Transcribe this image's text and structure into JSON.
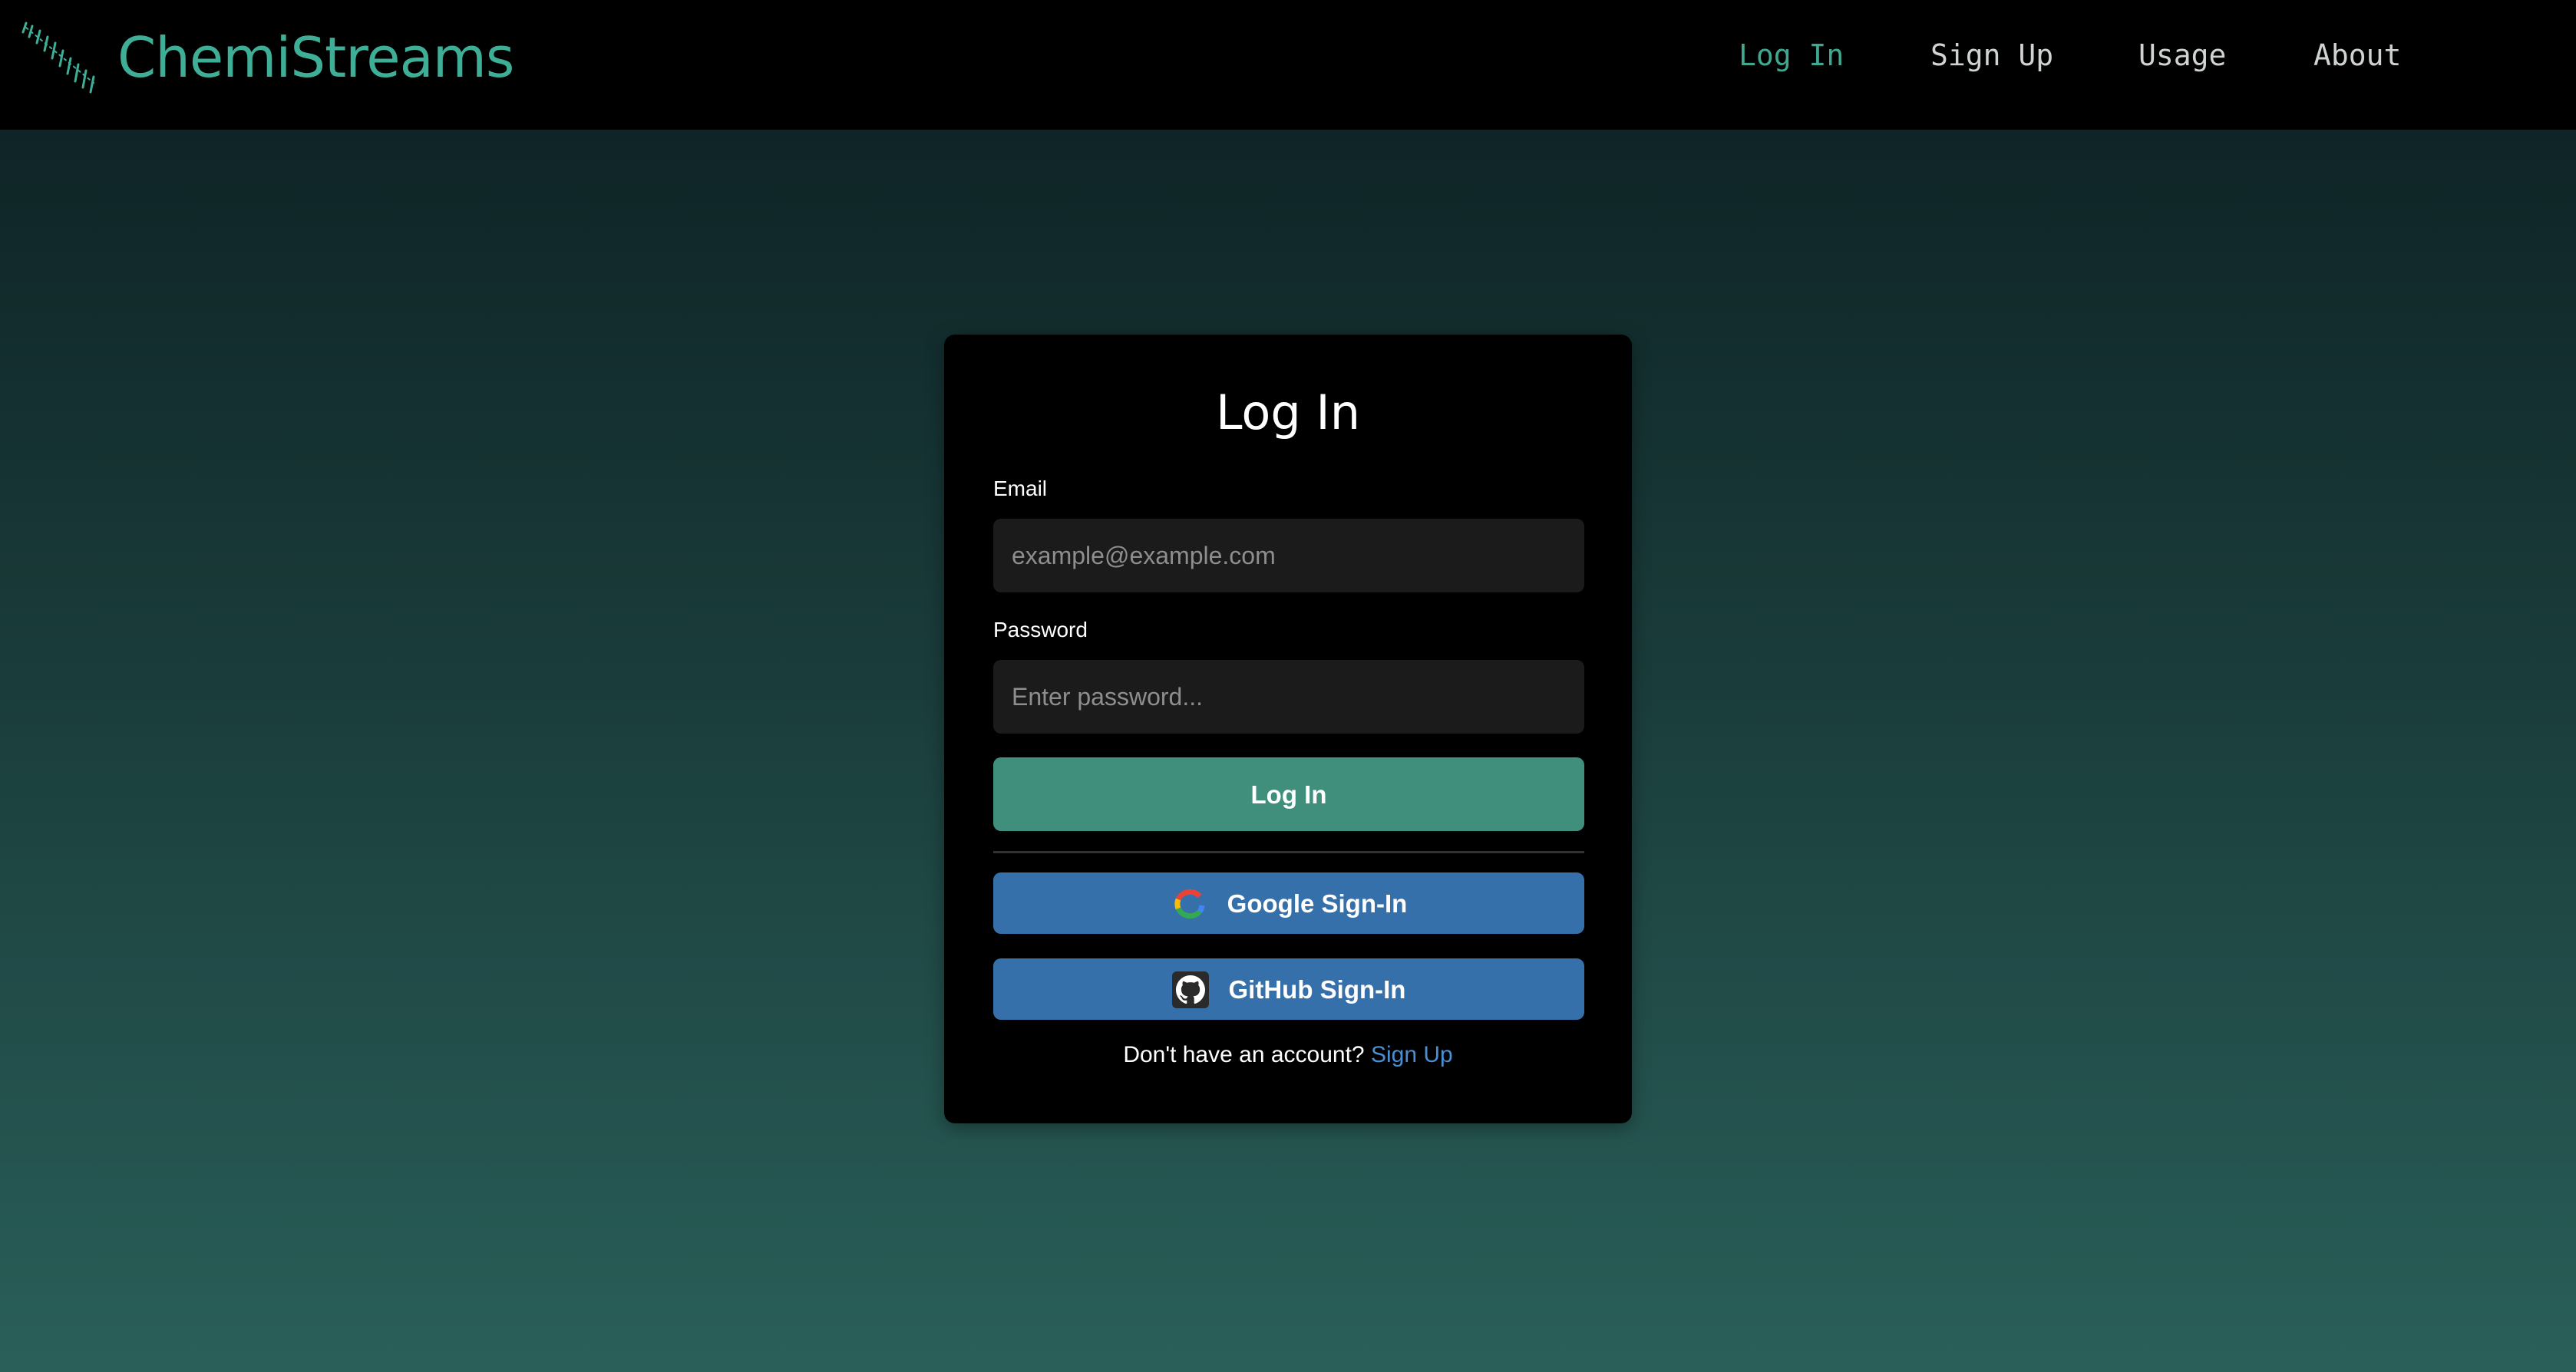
{
  "header": {
    "brand": "ChemiStreams",
    "logo_icon": "molecule-stream-icon",
    "nav": {
      "login": "Log In",
      "signup": "Sign Up",
      "usage": "Usage",
      "about": "About"
    },
    "active_nav": "login"
  },
  "login_form": {
    "title": "Log In",
    "email_label": "Email",
    "email_placeholder": "example@example.com",
    "email_value": "",
    "password_label": "Password",
    "password_placeholder": "Enter password...",
    "password_value": "",
    "submit_label": "Log In",
    "google_label": "Google Sign-In",
    "google_icon": "google-icon",
    "github_label": "GitHub Sign-In",
    "github_icon": "github-icon",
    "no_account_text": "Don't have an account?",
    "signup_link_label": "Sign Up"
  },
  "colors": {
    "brand": "#3fae96",
    "active_nav": "#3fa88f",
    "primary_button": "#3f8f7c",
    "oauth_button": "#3570aa",
    "link": "#4a8fd3"
  }
}
